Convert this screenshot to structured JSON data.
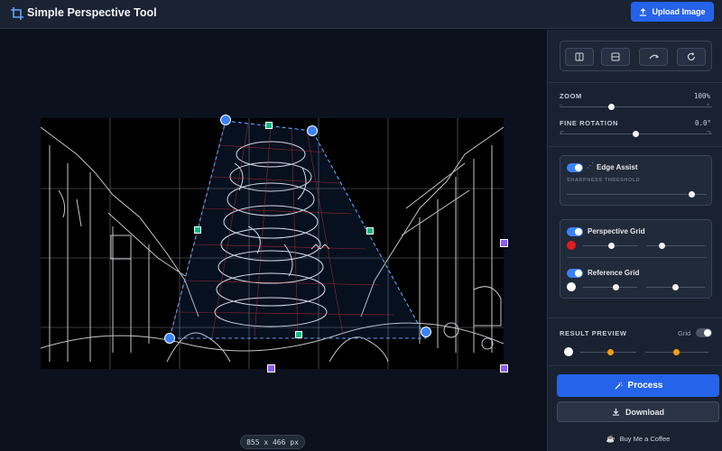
{
  "app": {
    "title": "Simple Perspective Tool",
    "upload_label": "Upload Image"
  },
  "canvas": {
    "dimensions": "855 x 466 px"
  },
  "toolbar": {
    "tools": [
      "flip-horizontal-icon",
      "flip-vertical-icon",
      "rotate-icon",
      "reset-icon"
    ]
  },
  "zoom": {
    "label": "ZOOM",
    "value_text": "100%",
    "level": 0.37
  },
  "fine_rotation": {
    "label": "FINE ROTATION",
    "value_text": "0.0°",
    "min_icon": "rotate-left-icon",
    "max_icon": "rotate-right-icon",
    "level": 0.5
  },
  "edge_assist": {
    "title": "Edge Assist",
    "enabled": true,
    "threshold_label": "SHARPNESS THRESHOLD",
    "threshold_level": 0.93
  },
  "perspective_grid": {
    "title": "Perspective Grid",
    "enabled": true,
    "color": "#e11d1d"
  },
  "reference_grid": {
    "title": "Reference Grid",
    "enabled": true,
    "color": "#ffffff"
  },
  "result_preview": {
    "label": "RESULT PREVIEW",
    "grid_label": "Grid",
    "grid_enabled": false
  },
  "actions": {
    "process_label": "Process",
    "download_label": "Download",
    "coffee_label": "Buy Me a Coffee"
  },
  "colors": {
    "accent": "#2563eb",
    "handle_blue": "#3b82f6",
    "handle_green": "#10b981",
    "handle_purple": "#8b5cf6",
    "slider_orange": "#f59e0b"
  }
}
